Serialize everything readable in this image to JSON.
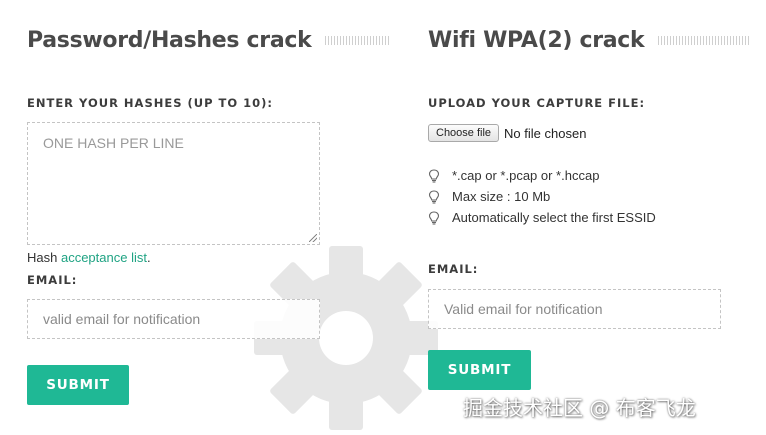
{
  "left": {
    "title": "Password/Hashes crack",
    "hashes_label": "ENTER YOUR HASHES (UP TO 10):",
    "hashes_placeholder": "ONE HASH PER LINE",
    "hash_note_prefix": "Hash ",
    "hash_note_link": "acceptance list",
    "hash_note_suffix": ".",
    "email_label": "EMAIL:",
    "email_placeholder": "valid email for notification",
    "submit_label": "SUBMIT"
  },
  "right": {
    "title": "Wifi WPA(2) crack",
    "upload_label": "UPLOAD YOUR CAPTURE FILE:",
    "choose_file_label": "Choose file",
    "file_status": "No file chosen",
    "tips": [
      "*.cap or *.pcap or *.hccap",
      "Max size : 10 Mb",
      "Automatically select the first ESSID"
    ],
    "email_label": "EMAIL:",
    "email_placeholder": "Valid email for notification",
    "submit_label": "SUBMIT"
  },
  "watermark": "掘金技术社区 @ 布客飞龙",
  "colors": {
    "accent": "#1fb895",
    "link": "#1fa383",
    "gear": "#e6e6e6"
  }
}
